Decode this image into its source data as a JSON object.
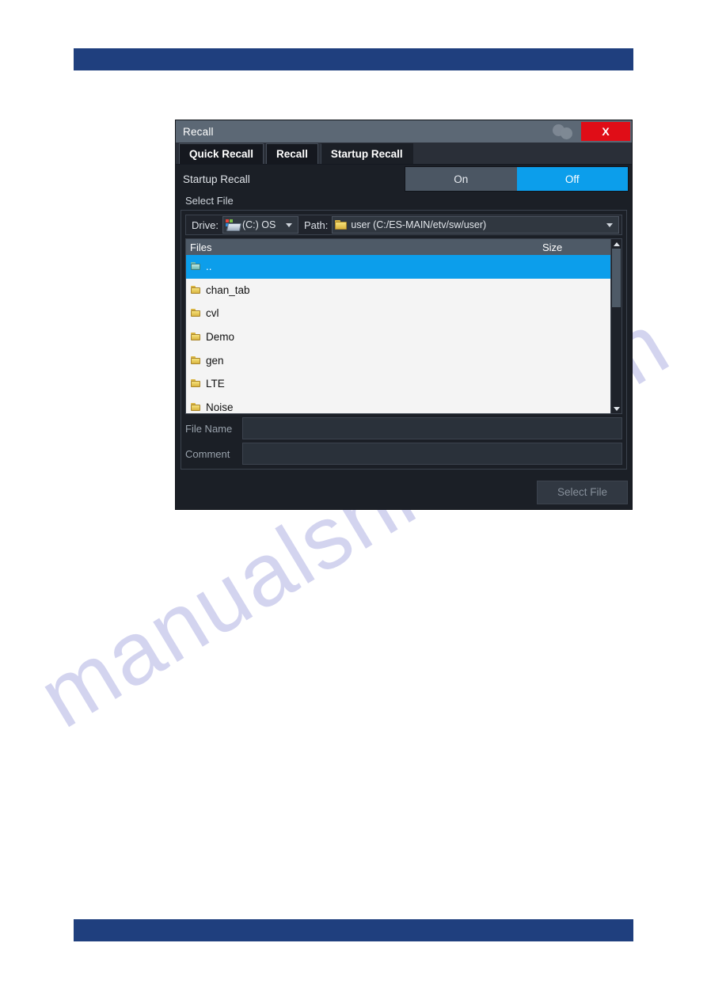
{
  "page": {
    "watermark": "manualshive.com",
    "header_bar_color": "#1f3f7e",
    "footer_bar_color": "#1f3f7e"
  },
  "dialog": {
    "title": "Recall",
    "titlebar": {
      "help_icon": "overlapping-circles-icon",
      "close_label": "X"
    },
    "tabs": [
      {
        "label": "Quick Recall",
        "active": false
      },
      {
        "label": "Recall",
        "active": false
      },
      {
        "label": "Startup Recall",
        "active": true
      }
    ],
    "startup_recall": {
      "label": "Startup Recall",
      "options": [
        {
          "label": "On",
          "selected": false
        },
        {
          "label": "Off",
          "selected": true
        }
      ],
      "selected_value": "Off",
      "selected_color": "#0c9eeb"
    },
    "select_file_group": {
      "title": "Select File",
      "drive": {
        "label": "Drive:",
        "icon": "hard-drive-icon",
        "value": "(C:) OS"
      },
      "path": {
        "label": "Path:",
        "icon": "folder-icon",
        "value": "user (C:/ES-MAIN/etv/sw/user)"
      },
      "filelist": {
        "columns": [
          "Files",
          "Size"
        ],
        "rows": [
          {
            "name": "..",
            "size": "",
            "selected": true,
            "type": "folder-up"
          },
          {
            "name": "chan_tab",
            "size": "",
            "selected": false,
            "type": "folder"
          },
          {
            "name": "cvl",
            "size": "",
            "selected": false,
            "type": "folder"
          },
          {
            "name": "Demo",
            "size": "",
            "selected": false,
            "type": "folder"
          },
          {
            "name": "gen",
            "size": "",
            "selected": false,
            "type": "folder"
          },
          {
            "name": "LTE",
            "size": "",
            "selected": false,
            "type": "folder"
          },
          {
            "name": "Noise",
            "size": "",
            "selected": false,
            "type": "folder"
          }
        ]
      },
      "file_name": {
        "label": "File Name",
        "value": "",
        "placeholder": ""
      },
      "comment": {
        "label": "Comment",
        "value": "",
        "placeholder": ""
      }
    },
    "footer": {
      "select_file_label": "Select File"
    }
  }
}
